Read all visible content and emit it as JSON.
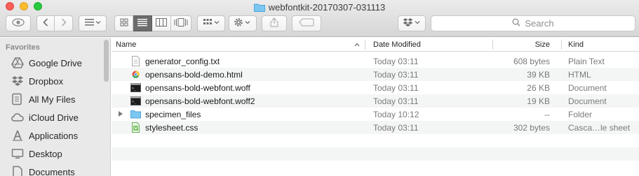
{
  "window": {
    "title": "webfontkit-20170307-031113"
  },
  "toolbar": {
    "search_placeholder": "Search",
    "icons": [
      "eye-icon",
      "back-icon",
      "forward-icon",
      "arrange-icon",
      "icon-view",
      "list-view",
      "column-view",
      "coverflow-view",
      "group-icon",
      "gear-icon",
      "share-icon",
      "tag-icon",
      "dropbox-icon",
      "search-icon"
    ]
  },
  "sidebar": {
    "heading": "Favorites",
    "items": [
      {
        "label": "Google Drive",
        "icon": "google-drive-icon"
      },
      {
        "label": "Dropbox",
        "icon": "dropbox-icon"
      },
      {
        "label": "All My Files",
        "icon": "all-files-icon"
      },
      {
        "label": "iCloud Drive",
        "icon": "cloud-icon"
      },
      {
        "label": "Applications",
        "icon": "applications-icon"
      },
      {
        "label": "Desktop",
        "icon": "desktop-icon"
      },
      {
        "label": "Documents",
        "icon": "documents-icon"
      }
    ]
  },
  "columns": {
    "name": "Name",
    "date": "Date Modified",
    "size": "Size",
    "kind": "Kind"
  },
  "files": [
    {
      "name": "generator_config.txt",
      "date": "Today 03:11",
      "size": "608 bytes",
      "kind": "Plain Text",
      "icon": "text-file-icon"
    },
    {
      "name": "opensans-bold-demo.html",
      "date": "Today 03:11",
      "size": "39 KB",
      "kind": "HTML",
      "icon": "chrome-html-icon"
    },
    {
      "name": "opensans-bold-webfont.woff",
      "date": "Today 03:11",
      "size": "26 KB",
      "kind": "Document",
      "icon": "terminal-doc-icon"
    },
    {
      "name": "opensans-bold-webfont.woff2",
      "date": "Today 03:11",
      "size": "19 KB",
      "kind": "Document",
      "icon": "terminal-doc-icon"
    },
    {
      "name": "specimen_files",
      "date": "Today 10:12",
      "size": "--",
      "kind": "Folder",
      "icon": "folder-icon"
    },
    {
      "name": "stylesheet.css",
      "date": "Today 03:11",
      "size": "302 bytes",
      "kind": "Casca…le sheet",
      "icon": "css-file-icon"
    }
  ]
}
